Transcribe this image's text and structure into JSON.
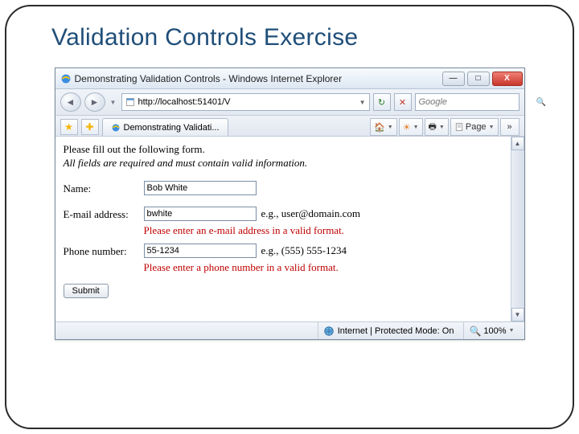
{
  "slide": {
    "title": "Validation Controls Exercise"
  },
  "window": {
    "title": "Demonstrating Validation Controls - Windows Internet Explorer",
    "minimize_glyph": "—",
    "maximize_glyph": "□",
    "close_glyph": "X"
  },
  "nav": {
    "back_glyph": "◄",
    "fwd_glyph": "►",
    "address": "http://localhost:51401/V",
    "refresh_glyph": "↻",
    "stop_glyph": "✕",
    "search_placeholder": "Google",
    "search_go_glyph": "🔍"
  },
  "tabs": {
    "active_label": "Demonstrating Validati...",
    "home_glyph": "🏠",
    "feeds_glyph": "☀",
    "print_glyph": "🖶",
    "page_label": "Page",
    "tools_label": "»"
  },
  "form": {
    "instr1": "Please fill out the following form.",
    "instr2": "All fields are required and must contain valid information.",
    "name_label": "Name:",
    "name_value": "Bob White",
    "email_label": "E-mail address:",
    "email_value": "bwhite",
    "email_hint": "e.g., user@domain.com",
    "email_error": "Please enter an e-mail address in a valid format.",
    "phone_label": "Phone number:",
    "phone_value": "55-1234",
    "phone_hint": "e.g., (555) 555-1234",
    "phone_error": "Please enter a phone number in a valid format.",
    "submit_label": "Submit"
  },
  "status": {
    "zone_text": "Internet | Protected Mode: On",
    "zoom_text": "100%"
  }
}
